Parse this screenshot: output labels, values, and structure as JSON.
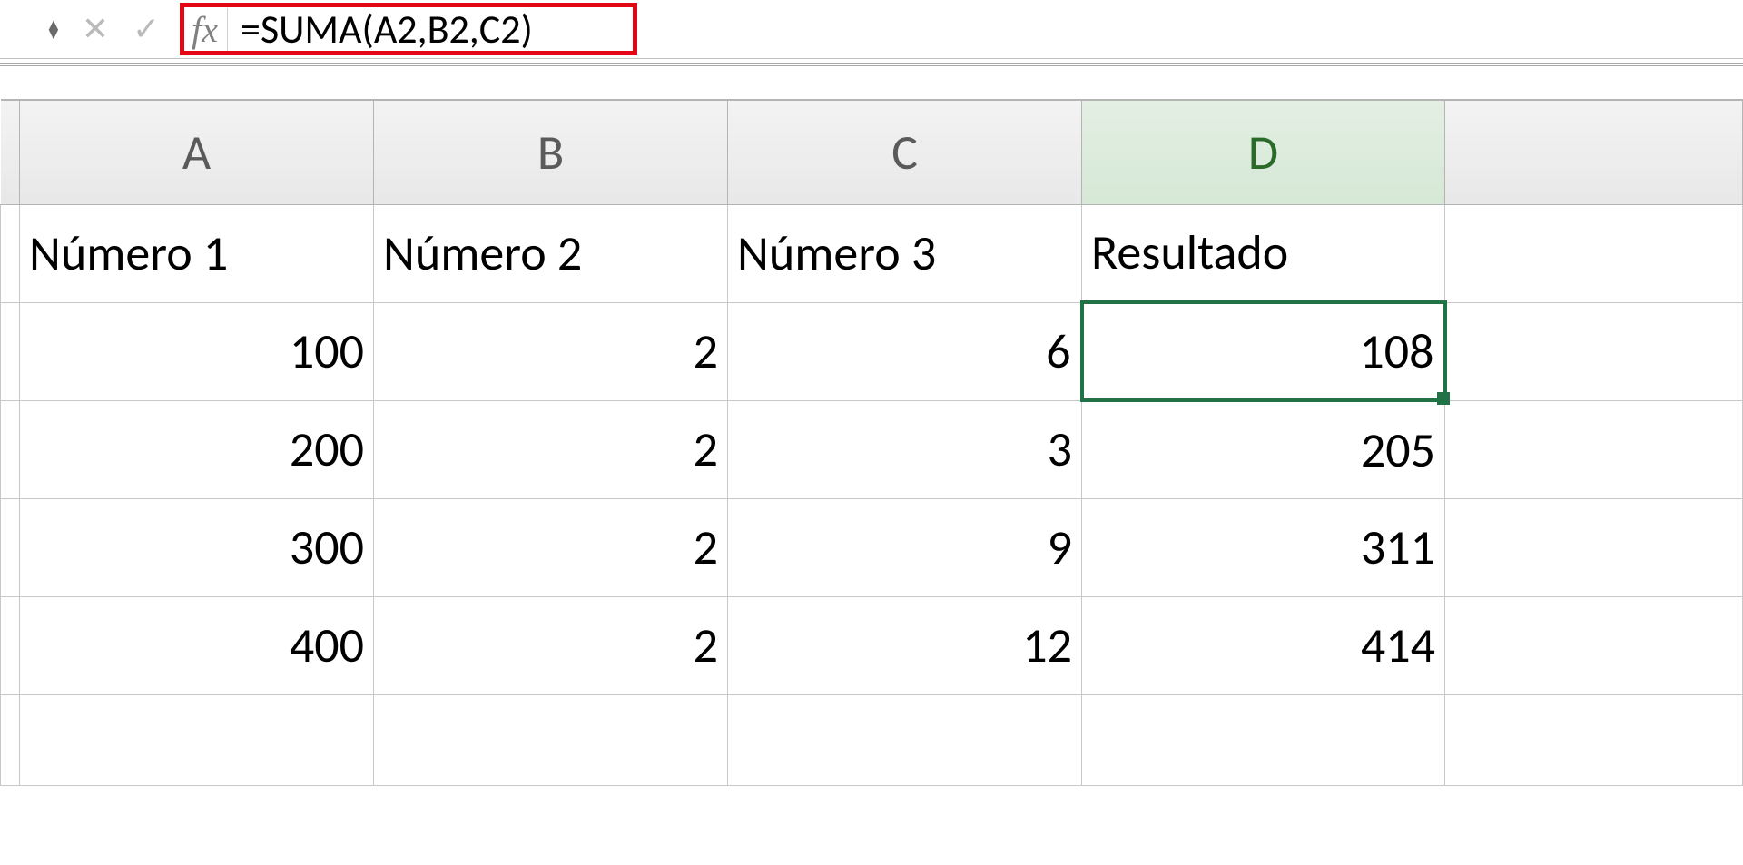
{
  "formula_bar": {
    "fx_label": "fx",
    "formula": "=SUMA(A2,B2,C2)"
  },
  "columns": [
    "A",
    "B",
    "C",
    "D"
  ],
  "headers": {
    "A": "Número 1",
    "B": "Número 2",
    "C": "Número 3",
    "D": "Resultado"
  },
  "rows": [
    {
      "A": "100",
      "B": "2",
      "C": "6",
      "D": "108"
    },
    {
      "A": "200",
      "B": "2",
      "C": "3",
      "D": "205"
    },
    {
      "A": "300",
      "B": "2",
      "C": "9",
      "D": "311"
    },
    {
      "A": "400",
      "B": "2",
      "C": "12",
      "D": "414"
    }
  ],
  "selected_cell": "D2"
}
